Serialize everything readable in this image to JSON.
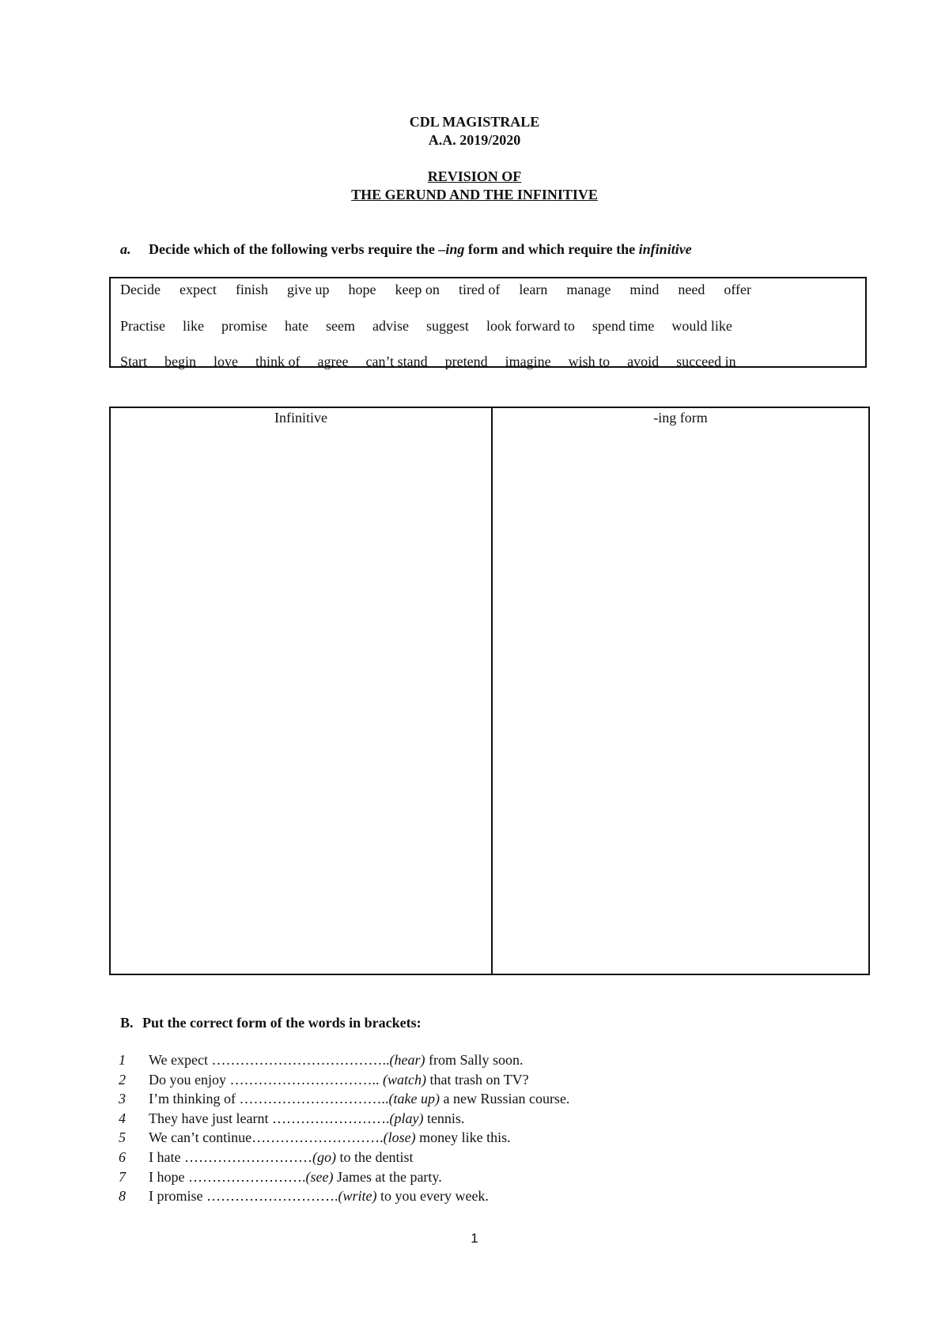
{
  "header": {
    "line1": "CDL MAGISTRALE",
    "line2": "A.A. 2019/2020",
    "title_line1": "REVISION OF",
    "title_line2": "THE GERUND AND THE INFINITIVE"
  },
  "section_a": {
    "letter": "a.",
    "instruction_part1": "Decide which of the following verbs require the ",
    "instruction_ing": "–ing",
    "instruction_part2": " form and which require the ",
    "instruction_inf": "infinitive",
    "verb_rows": [
      [
        "Decide",
        "expect",
        "finish",
        "give up",
        "hope",
        "keep on",
        "tired of",
        "learn",
        "manage",
        "mind",
        "need",
        "offer"
      ],
      [
        "Practise",
        "like",
        "promise",
        "hate",
        "seem",
        "advise",
        "suggest",
        "look forward to",
        "spend time",
        "would like"
      ],
      [
        "Start",
        "begin",
        "love",
        "think of",
        "agree",
        "can’t stand",
        "pretend",
        "imagine",
        "wish to",
        "avoid",
        "succeed in"
      ]
    ],
    "table_headers": {
      "left": "Infinitive",
      "right": "-ing form"
    }
  },
  "section_b": {
    "letter": "B.",
    "instruction": "Put the correct form of the words in brackets:",
    "exercises": [
      {
        "num": "1",
        "before": "We expect ",
        "dots": "………………………………..",
        "verb": "(hear)",
        "after": " from Sally soon."
      },
      {
        "num": "2",
        "before": "Do you enjoy ",
        "dots": "………………………….. ",
        "verb": "(watch)",
        "after": " that trash on TV?"
      },
      {
        "num": "3",
        "before": "I’m thinking of ",
        "dots": "…………………………..",
        "verb": "(take up)",
        "after": " a new Russian course."
      },
      {
        "num": "4",
        "before": "They have just learnt ",
        "dots": "…………………….",
        "verb": "(play)",
        "after": " tennis."
      },
      {
        "num": "5",
        "before": "We can’t continue",
        "dots": "……………………….",
        "verb": "(lose)",
        "after": " money like this."
      },
      {
        "num": "6",
        "before": "I hate ",
        "dots": "………………………",
        "verb": "(go)",
        "after": " to the dentist"
      },
      {
        "num": "7",
        "before": "I hope ",
        "dots": "…………………….",
        "verb": "(see)",
        "after": " James at the party."
      },
      {
        "num": "8",
        "before": "I promise ",
        "dots": "……………………….",
        "verb": "(write)",
        "after": " to you every week."
      }
    ]
  },
  "footer": {
    "page_number": "1"
  }
}
